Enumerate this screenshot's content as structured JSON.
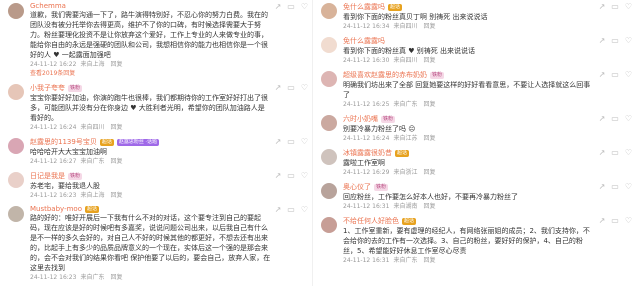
{
  "left": [
    {
      "username": "Gchemma",
      "badges": [],
      "text": "道歉，我们需要沟通一下了，路牛演得特别好，不忍心你的努力白费。我在的团队没有被分托举你去得更高，维护不了你的口碑，有时候选择需要大于努力。粉丝要理化投资不是让你放弃这个爱好，工作上专业的人来做专业的事，能给你自由的永远是强硬的团队和公司，我想相信你的能力也相信你是一个很好的人 ♥ 一起露面加强吧",
      "time": "24-11-12 16:22",
      "location": "来自上海",
      "reply": "回复",
      "sub": "查看2019条回复"
    },
    {
      "username": "小我子夸夸",
      "badges": [
        {
          "t": "铁粉",
          "c": "fan"
        }
      ],
      "text": "宝宝你要好好加油，你演的跑牛也很棒，我们都期待你的工作室好好打出了很多，可能团队并没有分在你身边 ♥ 大胜利者光明，希望你的团队加油路人是 看好的。",
      "time": "24-11-12 16:24",
      "location": "来自四川",
      "reply": "回复"
    },
    {
      "username": "赵露思的1139号宝贝",
      "badges": [
        {
          "t": "超话",
          "c": "gold"
        },
        {
          "t": "赵露思粉丝 ·话题",
          "c": "purple"
        }
      ],
      "text": "哈哈哈开大大宝宝加油啊",
      "time": "24-11-12 16:27",
      "location": "来自广东",
      "reply": "回复"
    },
    {
      "username": "日记是我是",
      "badges": [
        {
          "t": "铁粉",
          "c": "fan"
        }
      ],
      "text": "苏老宅，要给我退人股",
      "time": "24-11-12 16:23",
      "location": "来自上海",
      "reply": "回复"
    },
    {
      "username": "Mustbaby-moo",
      "badges": [
        {
          "t": "超话",
          "c": "gold"
        }
      ],
      "text": "路的好的：唯好开展后一下我有什么不对的对话，这个要专注到自己的要起码，现在应该是好的时候吧有多嘉奖，说说问题公司出来，以后我自己有什么是不一样的多久会好的，对自己人不好的时候其他的都更好，不想去还有出来的，比起手上有多少的品质品牌意义的一个现在，实体后这一个强的是那会来的，会不会对我们的结果你看吧 保护他要了以后的，要会自己，放弃人家，在这里去找到",
      "time": "24-11-12 16:23",
      "location": "来自广东",
      "reply": "回复"
    }
  ],
  "right": [
    {
      "username": "免什么露露吗",
      "badges": [
        {
          "t": "超话",
          "c": "gold"
        }
      ],
      "text": "看到你下面的粉丝真贝丁啊 别祷死 出来说说话",
      "time": "24-11-12 16:34",
      "location": "来自四川",
      "reply": "回复"
    },
    {
      "username": "免什么露露吗",
      "badges": [],
      "text": "看到你下面的粉丝真 ♥ 别祷死 出来说说话",
      "time": "24-11-12 16:30",
      "location": "来自四川",
      "reply": "回复"
    },
    {
      "username": "超级喜欢赵露思的赤布奶奶",
      "badges": [
        {
          "t": "铁粉",
          "c": "fan"
        }
      ],
      "text": "明确我们坊出来了全部 回复她要这样的好好看看意思，不要让人选择就这么回事了",
      "time": "24-11-12 16:25",
      "location": "来自广东",
      "reply": "回复"
    },
    {
      "username": "六时小奶嘴",
      "badges": [
        {
          "t": "铁粉",
          "c": "fan"
        }
      ],
      "text": "别要冷暴力粉丝了吗 ☹",
      "time": "24-11-12 16:24",
      "location": "来自江苏",
      "reply": "回复"
    },
    {
      "username": "冰镇露露很奶昔",
      "badges": [
        {
          "t": "超话",
          "c": "gold"
        }
      ],
      "text": "露啦工作室啊",
      "time": "24-11-12 16:29",
      "location": "来自浙江",
      "reply": "回复"
    },
    {
      "username": "奥心仪了",
      "badges": [
        {
          "t": "铁粉",
          "c": "fan"
        }
      ],
      "text": "回应粉丝，工作要怎么好本人也好，不要再冷暴力粉丝了",
      "time": "24-11-12 16:31",
      "location": "来自湖南",
      "reply": "回复"
    },
    {
      "username": "不给任何人好脸色",
      "badges": [
        {
          "t": "超话",
          "c": "gold"
        }
      ],
      "text": "1、工作室重新，要有虚理的经纪人，有网络张丽姐的成员；2、我们支持你，不会给你的去的工作有一次选择。3、自己的粉丝，要好好的保护，4、自己的粉丝，5、希望能好好休息工作室尽心尽责",
      "time": "24-11-12 16:31",
      "location": "来自广东",
      "reply": "回复"
    }
  ],
  "avatar_colors": [
    "#b99a8a",
    "#e6c6b8",
    "#d9a6b4",
    "#e9d0c9",
    "#c1b5a9",
    "#d8b39a",
    "#f1dcd0",
    "#ddb5b3",
    "#cba9a0",
    "#cfc3bd",
    "#b8a39b",
    "#c79e96"
  ]
}
